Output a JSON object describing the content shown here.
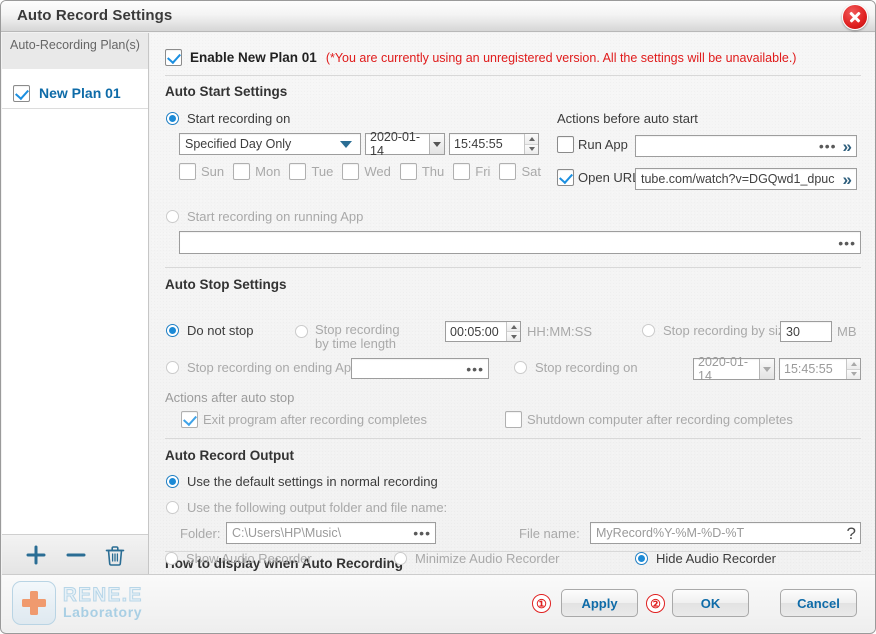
{
  "window": {
    "title": "Auto Record Settings",
    "close_icon": "close-icon"
  },
  "sidebar": {
    "header": "Auto-Recording Plan(s)",
    "plans": [
      {
        "label": "New Plan 01",
        "checked": true
      }
    ],
    "toolbar": {
      "add_icon": "plus-icon",
      "remove_icon": "minus-icon",
      "delete_icon": "trash-icon"
    }
  },
  "main": {
    "enable": {
      "label": "Enable New Plan 01",
      "checked": true,
      "notice": "(*You are currently using an unregistered version. All the settings will be unavailable.)"
    },
    "auto_start": {
      "title": "Auto Start Settings",
      "start_on_radio": "Start recording on",
      "day_mode": "Specified Day Only",
      "date": "2020-01-14",
      "time": "15:45:55",
      "weekdays": [
        "Sun",
        "Mon",
        "Tue",
        "Wed",
        "Thu",
        "Fri",
        "Sat"
      ],
      "start_on_app_radio": "Start recording on running App",
      "app_path": "",
      "actions_title": "Actions before auto start",
      "run_app_label": "Run App",
      "run_app_value": "",
      "open_url_label": "Open URL",
      "open_url_value": "tube.com/watch?v=DGQwd1_dpuc"
    },
    "auto_stop": {
      "title": "Auto Stop Settings",
      "do_not_stop": "Do not stop",
      "by_time_length": "Stop recording by time length",
      "time_length": "00:05:00",
      "time_format": "HH:MM:SS",
      "by_size": "Stop recording by size",
      "size_value": "30",
      "size_unit": "MB",
      "on_ending_app": "Stop recording on ending App",
      "ending_app_value": "",
      "stop_on": "Stop recording on",
      "stop_date": "2020-01-14",
      "stop_time": "15:45:55",
      "actions_title": "Actions after auto stop",
      "exit_program": "Exit program after recording completes",
      "shutdown_computer": "Shutdown computer after recording completes"
    },
    "output": {
      "title": "Auto Record Output",
      "default_radio": "Use the default settings in normal recording",
      "custom_radio": "Use the following output folder and file name:",
      "folder_label": "Folder:",
      "folder_value": "C:\\Users\\HP\\Music\\",
      "filename_label": "File name:",
      "filename_value": "MyRecord%Y-%M-%D-%T",
      "help_icon": "question-mark-icon"
    },
    "display": {
      "title": "How to display when Auto Recording",
      "show": "Show Audio Recorder",
      "minimize": "Minimize Audio Recorder",
      "hide": "Hide Audio Recorder"
    }
  },
  "footer": {
    "logo_line1": "RENE.E",
    "logo_line2": "Laboratory",
    "annotation_1": "①",
    "annotation_2": "②",
    "apply": "Apply",
    "ok": "OK",
    "cancel": "Cancel"
  }
}
